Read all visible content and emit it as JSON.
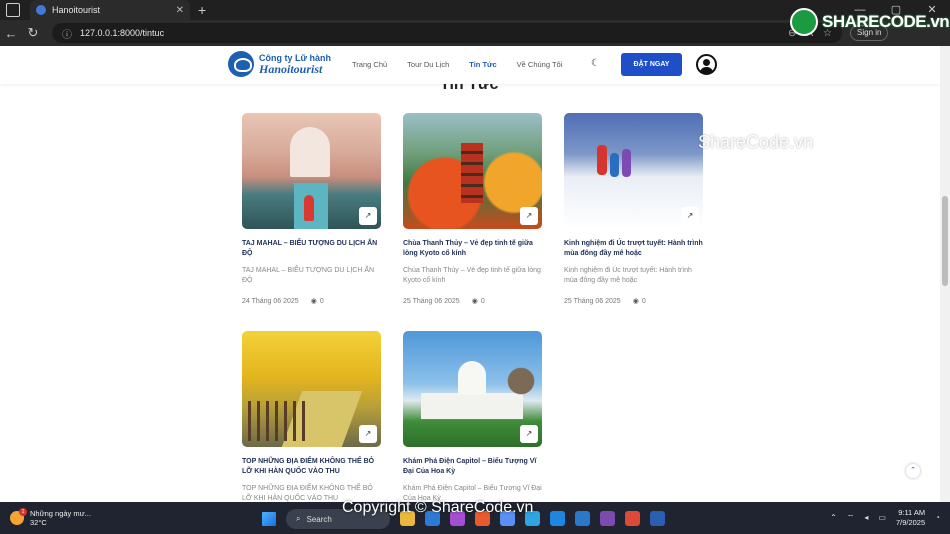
{
  "browser": {
    "tab_title": "Hanoitourist",
    "url": "127.0.0.1:8000/tintuc",
    "signin": "Sign in"
  },
  "watermark": {
    "logo_text": "SHARECODE.vn",
    "mid_text": "ShareCode.vn",
    "bottom_text": "Copyright © ShareCode.vn"
  },
  "header": {
    "logo_line1": "Công ty Lữ hành",
    "logo_line2": "Hanoitourist",
    "menu": [
      {
        "label": "Trang Chủ"
      },
      {
        "label": "Tour Du Lịch"
      },
      {
        "label": "Tin Tức"
      },
      {
        "label": "Về Chúng Tôi"
      }
    ],
    "book_button": "ĐẶT NGAY"
  },
  "section_title": "Tin Tức",
  "articles": [
    {
      "title": "TAJ MAHAL – BIỂU TƯỢNG DU LỊCH ẤN ĐỘ",
      "desc": "TAJ MAHAL – BIỂU TƯỢNG DU LỊCH ẤN ĐỘ",
      "date": "24 Tháng 06 2025",
      "views": "0"
    },
    {
      "title": "Chùa Thanh Thủy – Vẻ đẹp tinh tế giữa lòng Kyoto cổ kính",
      "desc": "Chùa Thanh Thủy – Vẻ đẹp tinh tế giữa lòng Kyoto cổ kính",
      "date": "25 Tháng 06 2025",
      "views": "0"
    },
    {
      "title": "Kinh nghiệm đi Úc trượt tuyết: Hành trình mùa đông đầy mê hoặc",
      "desc": "Kinh nghiệm đi Úc trượt tuyết: Hành trình mùa đông đầy mê hoặc",
      "date": "25 Tháng 06 2025",
      "views": "0"
    },
    {
      "title": "TOP NHỮNG ĐỊA ĐIỂM KHÔNG THỂ BỎ LỠ KHI HÀN QUỐC VÀO THU",
      "desc": "TOP NHỮNG ĐỊA ĐIỂM KHÔNG THỂ BỎ LỠ KHI HÀN QUỐC VÀO THU",
      "date": "",
      "views": ""
    },
    {
      "title": "Khám Phá Điện Capitol – Biểu Tượng Vĩ Đại Của Hoa Kỳ",
      "desc": "Khám Phá Điện Capitol – Biểu Tượng Vĩ Đại Của Hoa Kỳ",
      "date": "",
      "views": ""
    }
  ],
  "taskbar": {
    "weather_title": "Những ngày mư...",
    "weather_temp": "32°C",
    "weather_badge": "1",
    "search_placeholder": "Search",
    "time": "9:11 AM",
    "date": "7/9/2025"
  }
}
